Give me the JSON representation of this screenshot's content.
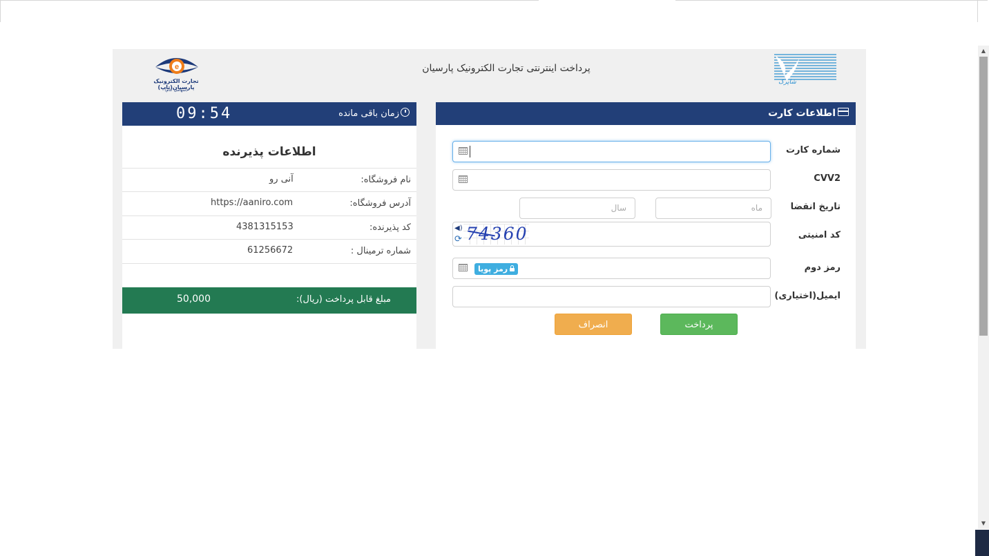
{
  "header": {
    "title": "پرداخت اینترنتی تجارت الکترونیک پارسیان",
    "left_logo_brand": "تجارت الکترونیک پارسیان(تاپ)",
    "left_logo_sub": "(سهامی عام)",
    "right_logo_name": "شاپرک",
    "left_logo_icon": "tap-logo-icon",
    "right_logo_icon": "shaparak-logo-icon"
  },
  "timer": {
    "label": "زمان باقی مانده",
    "value": "09:54",
    "icon": "clock-icon"
  },
  "merchant": {
    "title": "اطلاعات پذیرنده",
    "rows": [
      {
        "label": "نام فروشگاه:",
        "value": "آنی رو"
      },
      {
        "label": "آدرس فروشگاه:",
        "value": "https://aaniro.com"
      },
      {
        "label": "کد پذیرنده:",
        "value": "4381315153"
      },
      {
        "label": "شماره ترمینال :",
        "value": "61256672"
      }
    ],
    "amount_label": "مبلغ قابل پرداخت (ریال):",
    "amount_value": "50,000",
    "amount_color": "#237a52"
  },
  "card": {
    "title": "اطلاعات کارت",
    "icon": "credit-card-icon",
    "fields": {
      "card_number_label": "شماره کارت",
      "cvv2_label": "CVV2",
      "expiry_label": "تاریخ انقضا",
      "month_placeholder": "ماه",
      "year_placeholder": "سال",
      "captcha_label": "کد امنیتی",
      "captcha_text": "74360",
      "password_label": "رمز دوم",
      "dynamic_password_label": "رمز پویا",
      "email_label": "ایمیل(اختیاری)"
    },
    "buttons": {
      "pay": "پرداخت",
      "cancel": "انصراف"
    }
  },
  "colors": {
    "header_blue": "#223f78",
    "pay_green": "#5cb85c",
    "cancel_orange": "#f0ad4e",
    "badge_blue": "#3faee0"
  }
}
